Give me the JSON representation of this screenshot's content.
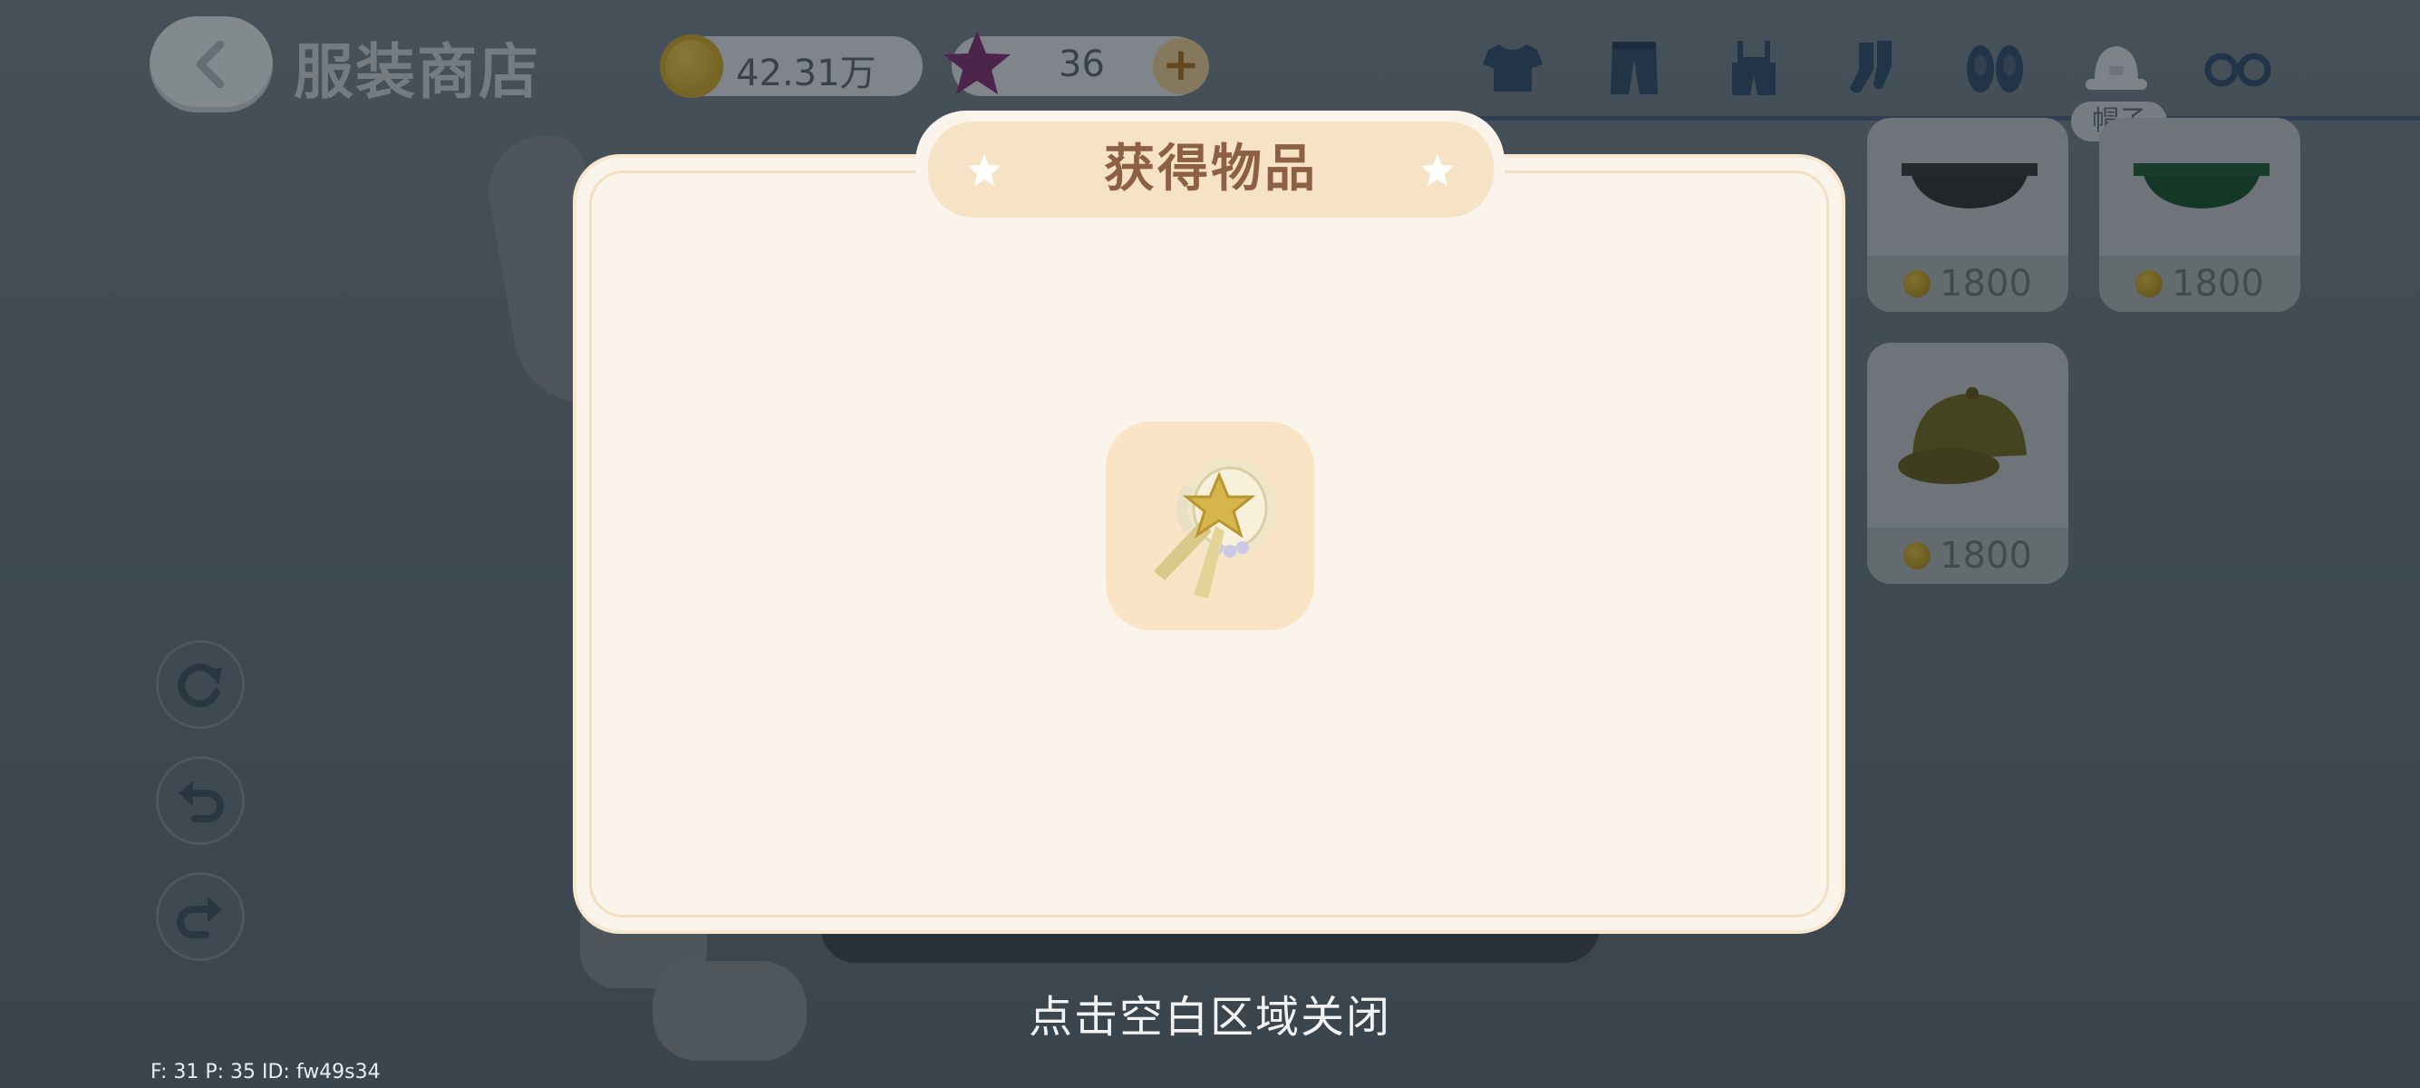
{
  "header": {
    "title": "服装商店",
    "coins": "42.31万",
    "stars": "36",
    "plus_label": "+"
  },
  "category_tabs": [
    {
      "name": "shirt-icon"
    },
    {
      "name": "pants-icon"
    },
    {
      "name": "overalls-icon"
    },
    {
      "name": "socks-icon"
    },
    {
      "name": "slippers-icon"
    },
    {
      "name": "hat-icon",
      "label": "帽子",
      "selected": true
    },
    {
      "name": "glasses-icon"
    }
  ],
  "shop_items": [
    {
      "price": "1800",
      "color": "#3a3a3a"
    },
    {
      "price": "1800",
      "color": "#1d5a32"
    },
    {
      "price": "1800",
      "color": "#6e6420"
    }
  ],
  "modal": {
    "title": "获得物品",
    "close_hint": "点击空白区域关闭"
  },
  "debug": "F: 31    P: 35    ID: fw49s34",
  "colors": {
    "modal_bg": "#fbf4ea",
    "title_tab": "#f6e3c6",
    "title_text": "#8d5f43",
    "reward_tile": "#fbe3c5"
  }
}
